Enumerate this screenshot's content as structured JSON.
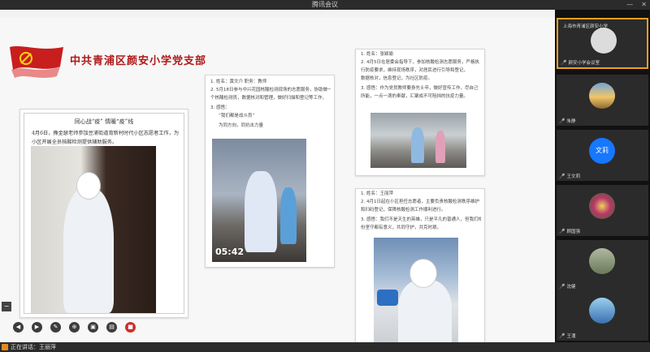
{
  "window": {
    "title": "腾讯会议"
  },
  "slide": {
    "org_title": "中共青浦区颜安小学党支部",
    "card_a": {
      "headline": "同心战“疫”  情暖“疫”线",
      "text": "4月6日，豫金瑟老师参加豆浦街道育新村时代小区志愿者工作，为小区开展全员核酸检测提供辅助服务。"
    },
    "card_b": {
      "lines": [
        "1. 姓名：黄文介    职务：教师",
        "2. 5月18日参与中兴花园核酸检测现场的志愿服务，协助做一",
        "个核酸检测员，数据核对和管理，做好扫描和登记等工作，",
        "3. 感悟：",
        "“我们都是战斗员”",
        "为同方向，同抗击力量"
      ],
      "photo_time": "05:42"
    },
    "card_c": {
      "lines": [
        "1. 姓名：张颖瑜",
        "2. 4月5日在居委会指导下，参加核酸检测志愿服务，严格执",
        "行防疫要求，维持现场秩序，对居民进行引导和登记，",
        "数据核对，信息登记，为社区防疫。",
        "3. 感悟：作为党员教师要身先士卒，做好宣传工作，尽自己",
        "所能，一点一滴的奉献，汇聚成不可阻挡的抗疫力量。"
      ]
    },
    "card_d": {
      "lines": [
        "1. 姓名：王丽萍",
        "2. 4月1日起在小区担任志愿者，主要负责核酸检测秩序维护",
        "和扫码登记，保障核酸检测工作顺利进行。",
        "3. 感悟：我们不是天生的英雄，只是平凡的普通人，但我们相信，每",
        "份坚守都有意义，共同守护，共克时艰。"
      ]
    }
  },
  "bottom": {
    "speaker": "正在讲话：王丽萍"
  },
  "participants": [
    {
      "name": "上海市青浦区颜安小学",
      "label": "颜安小学会议室",
      "avatar_color": "#dcdcdc",
      "active": true
    },
    {
      "name": "朱静",
      "label": "朱静",
      "avatar_color": "#d8a24a",
      "active": false
    },
    {
      "name": "文莉",
      "label": "王文莉",
      "avatar_color": "#1677ff",
      "active": false,
      "initials": "文莉"
    },
    {
      "name": "顾国强",
      "label": "顾国强",
      "avatar_color": "#b8386a",
      "active": false
    },
    {
      "name": "沈健",
      "label": "沈健",
      "avatar_color": "#8a9a7a",
      "active": false
    },
    {
      "name": "王涌",
      "label": "王涌",
      "avatar_color": "#3b6fb0",
      "active": false
    }
  ],
  "colors": {
    "accent": "#f0a020",
    "party_red": "#b01818",
    "stop": "#d12c2c"
  }
}
